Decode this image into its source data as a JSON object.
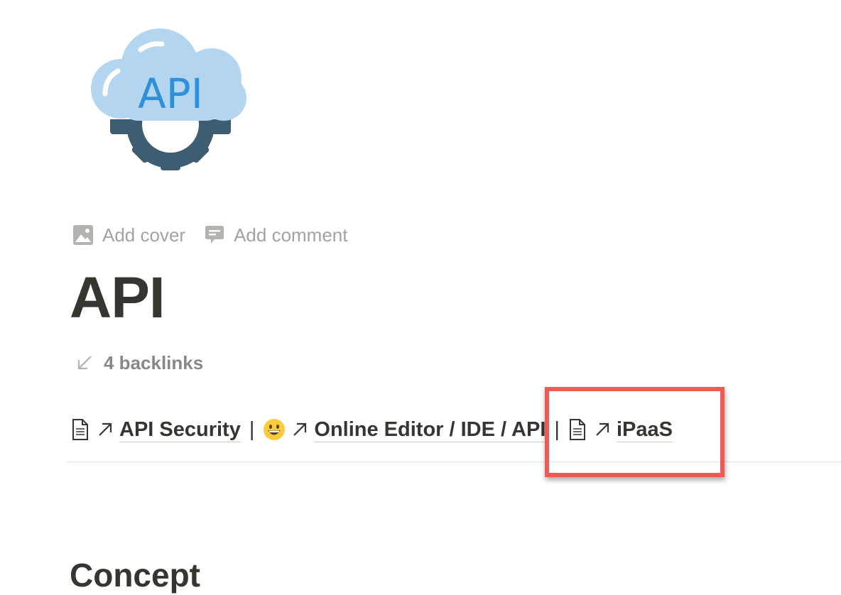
{
  "page": {
    "icon": {
      "name": "api-cloud-gear-icon",
      "text": "API",
      "colors": {
        "cloud": "#b3d5ef",
        "text": "#2f8fd8",
        "gear": "#3f5d71"
      }
    },
    "controls": [
      {
        "label": "Add cover",
        "icon": "image-icon"
      },
      {
        "label": "Add comment",
        "icon": "comment-icon"
      }
    ],
    "title": "API",
    "backlinks": {
      "icon": "arrow-down-left-icon",
      "label": "4 backlinks"
    },
    "mentions": [
      {
        "icon": "document-icon",
        "title": "API Security"
      },
      {
        "icon": "grinning-face-emoji",
        "title": "Online Editor / IDE / API"
      },
      {
        "icon": "document-icon",
        "title": "iPaaS"
      }
    ],
    "separator": "|",
    "heading": "Concept",
    "highlight_color": "#f05a55"
  }
}
